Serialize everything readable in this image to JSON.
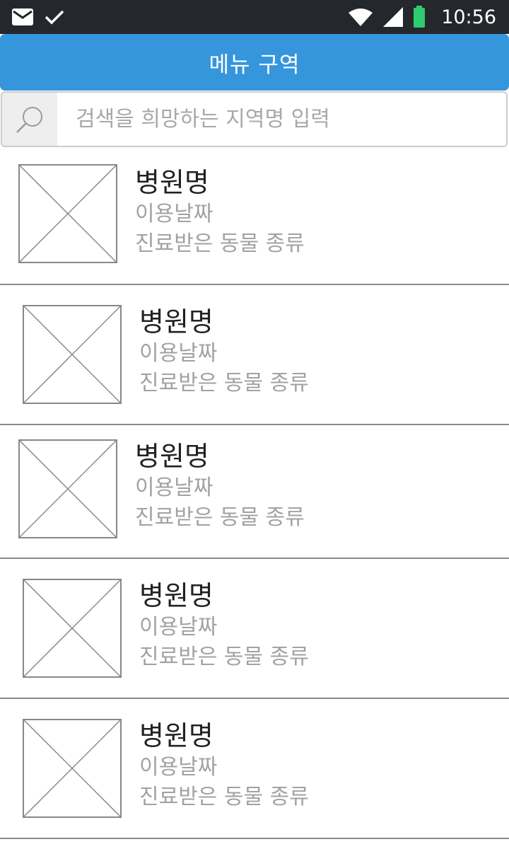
{
  "status_bar": {
    "time": "10:56",
    "icons": [
      "mail-icon",
      "check-icon",
      "wifi-icon",
      "signal-icon",
      "battery-icon"
    ],
    "battery_color": "#2ecc71"
  },
  "menu": {
    "title": "메뉴 구역",
    "color": "#3596db"
  },
  "search": {
    "placeholder": "검색을 희망하는 지역명 입력",
    "value": ""
  },
  "items": [
    {
      "name": "병원명",
      "date": "이용날짜",
      "animal": "진료받은 동물 종류"
    },
    {
      "name": "병원명",
      "date": "이용날짜",
      "animal": "진료받은 동물 종류"
    },
    {
      "name": "병원명",
      "date": "이용날짜",
      "animal": "진료받은 동물 종류"
    },
    {
      "name": "병원명",
      "date": "이용날짜",
      "animal": "진료받은 동물 종류"
    },
    {
      "name": "병원명",
      "date": "이용날짜",
      "animal": "진료받은 동물 종류"
    }
  ]
}
